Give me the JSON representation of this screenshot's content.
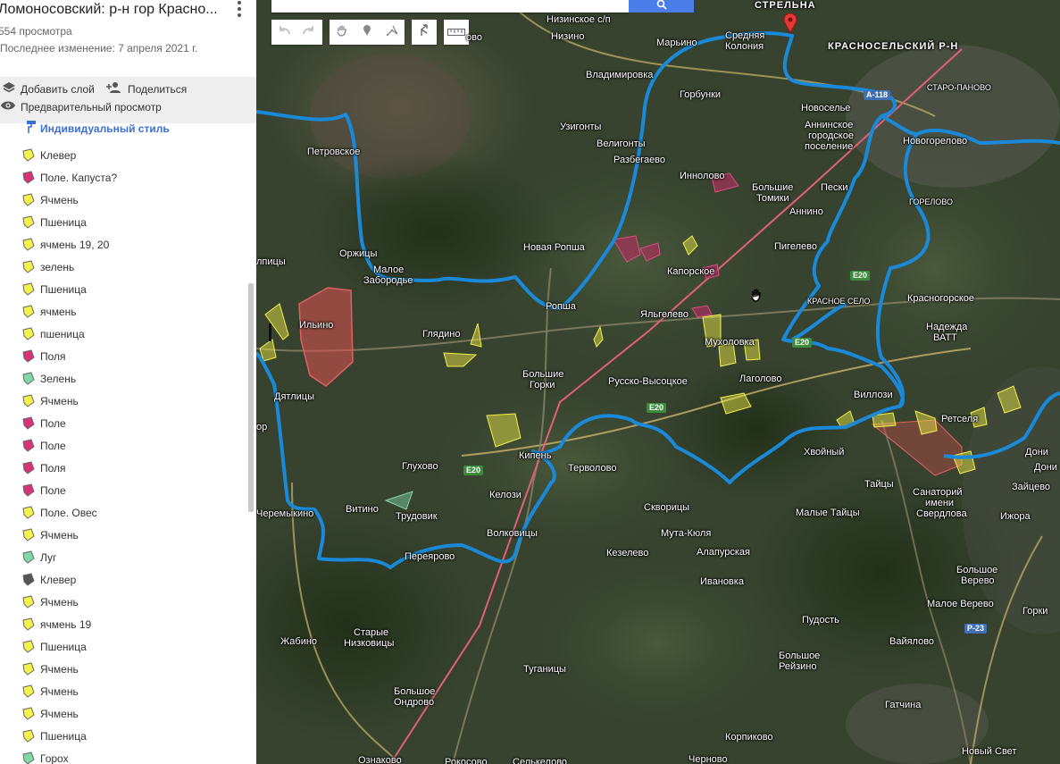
{
  "sidebar": {
    "title": "Ломоносовский: р-н гор Красно...",
    "views": "554 просмотра",
    "modified": "Последнее изменение: 7 апреля 2021 г.",
    "add_layer": "Добавить слой",
    "share": "Поделиться",
    "preview": "Предварительный просмотр",
    "style_label": "Индивидуальный стиль",
    "features": [
      {
        "label": "Клевер",
        "color": "#f5f24a"
      },
      {
        "label": "Поле. Капуста?",
        "color": "#d8337a"
      },
      {
        "label": "Ячмень",
        "color": "#f5f24a"
      },
      {
        "label": "Пшеница",
        "color": "#f5f24a"
      },
      {
        "label": "ячмень 19, 20",
        "color": "#f5f24a"
      },
      {
        "label": "зелень",
        "color": "#f5f24a"
      },
      {
        "label": "Пшеница",
        "color": "#f5f24a"
      },
      {
        "label": "ячмень",
        "color": "#f5f24a"
      },
      {
        "label": "пшеница",
        "color": "#f5f24a"
      },
      {
        "label": "Поля",
        "color": "#d8337a"
      },
      {
        "label": "Зелень",
        "color": "#7fd8a8"
      },
      {
        "label": "Ячмень",
        "color": "#f5f24a"
      },
      {
        "label": "Поле",
        "color": "#d8337a"
      },
      {
        "label": "Поле",
        "color": "#d8337a"
      },
      {
        "label": "Поля",
        "color": "#d8337a"
      },
      {
        "label": "Поле",
        "color": "#d8337a"
      },
      {
        "label": "Поле. Овес",
        "color": "#f5f24a"
      },
      {
        "label": "Ячмень",
        "color": "#f5f24a"
      },
      {
        "label": "Луг",
        "color": "#7fd8a8"
      },
      {
        "label": "Клевер",
        "color": "#555555"
      },
      {
        "label": "Ячмень",
        "color": "#f5f24a"
      },
      {
        "label": "ячмень 19",
        "color": "#f5f24a"
      },
      {
        "label": "Пшеница",
        "color": "#f5f24a"
      },
      {
        "label": "Ячмень",
        "color": "#f5f24a"
      },
      {
        "label": "Ячмень",
        "color": "#f5f24a"
      },
      {
        "label": "Ячмень",
        "color": "#f5f24a"
      },
      {
        "label": "Пшеница",
        "color": "#f5f24a"
      },
      {
        "label": "Горох",
        "color": "#7fd8a8"
      }
    ]
  },
  "map": {
    "colors": {
      "boundary": "#1a8ad8",
      "search_button": "#4b7ee8",
      "field_yellow": "#f5f24a",
      "field_red": "#e05050",
      "field_magenta": "#a8305a"
    },
    "labels": {
      "strelna": "СТРЕЛЬНА",
      "nizinskoe": "Низинское с/п",
      "nizino": "Низино",
      "marino": "Марьино",
      "srednyaya": "Средняя",
      "kolonia": "Колония",
      "krasnoselsky": "КРАСНОСЕЛЬСКИЙ Р-Н",
      "staro_panovo": "СТАРО-ПАНОВО",
      "vladimirovka": "Владимировка",
      "gorbunki": "Горбунки",
      "novoselye": "Новоселье",
      "anninskoe1": "Аннинское",
      "anninskoe2": "городское",
      "anninskoe3": "поселение",
      "uzigonty": "Узигонты",
      "velikonty": "Велигонты",
      "razbegaevo": "Разбегаево",
      "novogorelovo": "Новогорелово",
      "petrovskoe": "Петровское",
      "innolovo": "Инноловo",
      "bolshie": "Большие",
      "tomiki": "Томики",
      "peski": "Пески",
      "annino": "Аннино",
      "gorelovo": "ГОРЕЛОВО",
      "novaya_ropsha": "Новая Ропша",
      "pigelevo": "Пигелево",
      "orzhitsy": "Оржицы",
      "maloe": "Малое",
      "zabrodye": "Забородье",
      "kaporskoe": "Капорское",
      "krasnoe_selo": "КРАСНОЕ СЕЛО",
      "krasnogorskoe": "Красногорское",
      "ropsha": "Ропша",
      "yalgelevo": "Яльгелево",
      "nadezhda1": "Надежда",
      "nadezhda2": "ВАТТ",
      "ilyino": "Ильино",
      "glyadino": "Глядино",
      "mukholovka": "Мухоловка",
      "dyatlitsy": "Дятлицы",
      "bolshie_gorki1": "Большие",
      "bolshie_gorki2": "Горки",
      "russko": "Русско-Высоцкое",
      "lagolovo": "Лаголово",
      "villozi": "Виллози",
      "retselya": "Ретселя",
      "khvoyny": "Хвойный",
      "kipen": "Кипень",
      "terbolovo": "Терволово",
      "glukhovo": "Глухово",
      "kelozi": "Келози",
      "taitsy": "Тайцы",
      "sanatory1": "Санаторий",
      "sanatory2": "имени",
      "sanatory3": "Свердлова",
      "zaitsevo": "Зайцево",
      "doni": "Дони",
      "chermykino": "Черемыкино",
      "vitino": "Витино",
      "trudovik": "Трудовик",
      "skvoritsy": "Скворицы",
      "malye_taitsy": "Малые Тайцы",
      "izhora": "Ижора",
      "volkovitsy": "Волковицы",
      "pereyarovo": "Переярово",
      "muta": "Мута-Кюля",
      "kezelevo": "Кезелево",
      "alapurskaya": "Алапурская",
      "ivanovka": "Ивановка",
      "bolshoe_verevo1": "Большое",
      "bolshoe_verevo2": "Верево",
      "maloe_verevo": "Малое Верево",
      "gorki": "Горки",
      "pudost": "Пудость",
      "zhabino": "Жабино",
      "starye1": "Старые",
      "starye2": "Низковицы",
      "vayalovo": "Вайялово",
      "tuganitsy": "Туганицы",
      "bolshoe_reyzino1": "Большое",
      "bolshoe_reyzino2": "Рейзино",
      "bolshoe_ondrovo1": "Большое",
      "bolshoe_ondrovo2": "Ондрово",
      "gatchina": "Гатчина",
      "korpikovo": "Корпиково",
      "novy_svet": "Новый Свет",
      "oznakovo": "Ознаково",
      "chernovo": "Черново",
      "rok": "Рокосово",
      "sel": "Селькелово",
      "lpitsy": "лпицы",
      "or": "ор",
      "ovo": "ово"
    },
    "roads": {
      "a118": "А-118",
      "e20a": "E20",
      "e20b": "E20",
      "e20c": "E20",
      "e20d": "E20",
      "p23": "Р-23"
    }
  }
}
